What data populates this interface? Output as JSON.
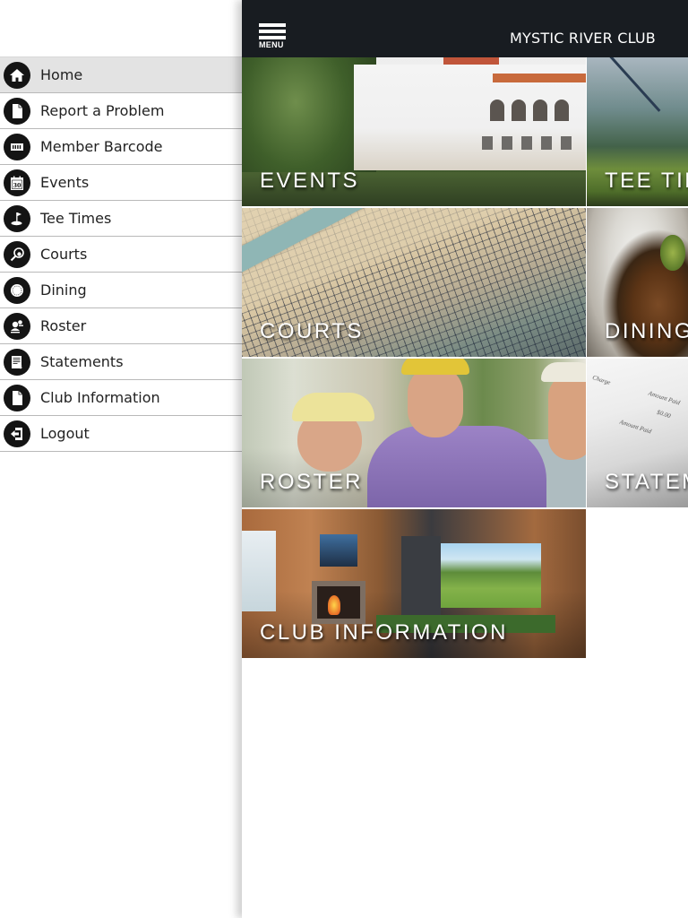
{
  "header": {
    "menu_button_label": "MENU",
    "club_title": "MYSTIC RIVER CLUB"
  },
  "sidebar": {
    "active_index": 0,
    "items": [
      {
        "label": "Home",
        "icon": "home-icon"
      },
      {
        "label": "Report a Problem",
        "icon": "document-icon"
      },
      {
        "label": "Member Barcode",
        "icon": "barcode-icon"
      },
      {
        "label": "Events",
        "icon": "calendar-icon",
        "icon_text": "30"
      },
      {
        "label": "Tee Times",
        "icon": "golf-flag-icon"
      },
      {
        "label": "Courts",
        "icon": "tennis-racket-icon"
      },
      {
        "label": "Dining",
        "icon": "plate-icon"
      },
      {
        "label": "Roster",
        "icon": "people-icon"
      },
      {
        "label": "Statements",
        "icon": "statement-icon"
      },
      {
        "label": "Club Information",
        "icon": "document-icon"
      },
      {
        "label": "Logout",
        "icon": "logout-icon"
      }
    ]
  },
  "tiles": [
    {
      "label": "EVENTS"
    },
    {
      "label": "TEE TIMES"
    },
    {
      "label": "COURTS"
    },
    {
      "label": "DINING"
    },
    {
      "label": "ROSTER"
    },
    {
      "label": "STATEMENTS"
    },
    {
      "label": "CLUB INFORMATION"
    }
  ],
  "statement_photo_text": {
    "charge": "Charge",
    "amount_paid": "Amount Paid",
    "amount": "$0.00"
  },
  "colors": {
    "header_bg": "#181c21",
    "active_item_bg": "#e3e3e3",
    "icon_circle": "#141414"
  }
}
